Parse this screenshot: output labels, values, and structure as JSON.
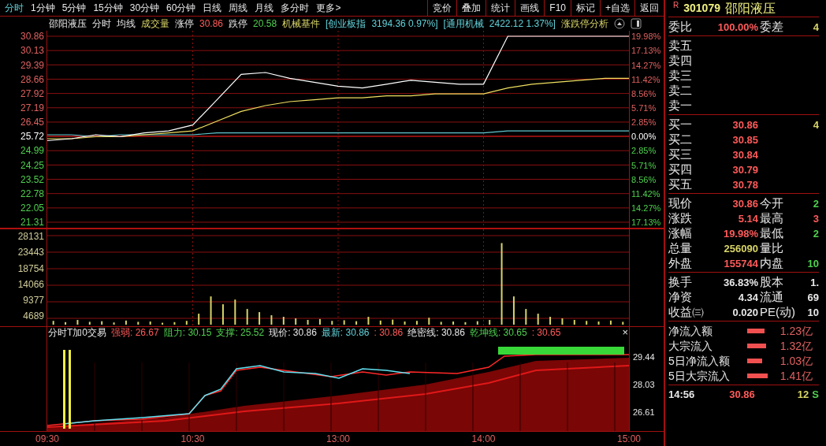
{
  "menu": {
    "tabs": [
      {
        "label": "分时",
        "selected": true
      },
      {
        "label": "1分钟",
        "selected": false
      },
      {
        "label": "5分钟",
        "selected": false
      },
      {
        "label": "15分钟",
        "selected": false
      },
      {
        "label": "30分钟",
        "selected": false
      },
      {
        "label": "60分钟",
        "selected": false
      },
      {
        "label": "日线",
        "selected": false
      },
      {
        "label": "周线",
        "selected": false
      },
      {
        "label": "月线",
        "selected": false
      },
      {
        "label": "多分时",
        "selected": false
      },
      {
        "label": "更多>",
        "selected": false
      }
    ],
    "tools": [
      "竞价",
      "叠加",
      "统计",
      "画线",
      "F10",
      "标记",
      "+自选",
      "返回"
    ]
  },
  "chart_header": [
    {
      "text": "邵阳液压",
      "kind": "flat"
    },
    {
      "text": "分时",
      "kind": "flat"
    },
    {
      "text": "均线",
      "kind": "flat"
    },
    {
      "text": "成交量",
      "kind": "vol"
    },
    {
      "text": "涨停",
      "kind": "flat"
    },
    {
      "text": "30.86",
      "kind": "up"
    },
    {
      "text": "跌停",
      "kind": "flat"
    },
    {
      "text": "20.58",
      "kind": "down"
    },
    {
      "text": "机械基件",
      "kind": "vol"
    },
    {
      "text": "[创业板指",
      "kind": "index"
    },
    {
      "text": "3194.36 0.97%]",
      "kind": "index"
    },
    {
      "text": "[通用机械",
      "kind": "index"
    },
    {
      "text": "2422.12 1.37%]",
      "kind": "index"
    },
    {
      "text": "涨跌停分析",
      "kind": "vol"
    }
  ],
  "price_axis": [
    {
      "label": "30.86",
      "kind": "up"
    },
    {
      "label": "30.13",
      "kind": "up"
    },
    {
      "label": "29.39",
      "kind": "up"
    },
    {
      "label": "28.66",
      "kind": "up"
    },
    {
      "label": "27.92",
      "kind": "up"
    },
    {
      "label": "27.19",
      "kind": "up"
    },
    {
      "label": "26.45",
      "kind": "up"
    },
    {
      "label": "25.72",
      "kind": "flat"
    },
    {
      "label": "24.99",
      "kind": "down"
    },
    {
      "label": "24.25",
      "kind": "down"
    },
    {
      "label": "23.52",
      "kind": "down"
    },
    {
      "label": "22.78",
      "kind": "down"
    },
    {
      "label": "22.05",
      "kind": "down"
    },
    {
      "label": "21.31",
      "kind": "down"
    }
  ],
  "percent_axis": [
    {
      "label": "19.98%",
      "kind": "up"
    },
    {
      "label": "17.13%",
      "kind": "up"
    },
    {
      "label": "14.27%",
      "kind": "up"
    },
    {
      "label": "11.42%",
      "kind": "up"
    },
    {
      "label": "8.56%",
      "kind": "up"
    },
    {
      "label": "5.71%",
      "kind": "up"
    },
    {
      "label": "2.85%",
      "kind": "up"
    },
    {
      "label": "0.00%",
      "kind": "flat"
    },
    {
      "label": "2.85%",
      "kind": "down"
    },
    {
      "label": "5.71%",
      "kind": "down"
    },
    {
      "label": "8.56%",
      "kind": "down"
    },
    {
      "label": "11.42%",
      "kind": "down"
    },
    {
      "label": "14.27%",
      "kind": "down"
    },
    {
      "label": "17.13%",
      "kind": "down"
    }
  ],
  "volume_axis": [
    "28131",
    "23443",
    "18754",
    "14066",
    "9377",
    "4689"
  ],
  "indicator": {
    "title": "分时T加0交易",
    "segments": [
      {
        "text": "强弱: 26.67",
        "kind": "up"
      },
      {
        "text": "阻力: 30.15",
        "kind": "down"
      },
      {
        "text": "支撑: 25.52",
        "kind": "down"
      },
      {
        "text": "现价: 30.86",
        "kind": "flat"
      },
      {
        "text": "最新: 30.86",
        "kind": "index"
      },
      {
        "text": ": 30.86",
        "kind": "up"
      },
      {
        "text": "绝密线: 30.86",
        "kind": "flat"
      },
      {
        "text": "乾坤线: 30.65",
        "kind": "down"
      },
      {
        "text": ": 30.65",
        "kind": "up"
      }
    ],
    "close": "×",
    "axis": [
      "29.44",
      "28.03",
      "26.61"
    ]
  },
  "time_axis": [
    "09:30",
    "10:30",
    "13:00",
    "14:00",
    "15:00"
  ],
  "quote": {
    "badge": "R",
    "code": "301079",
    "name": "邵阳液压",
    "committee": [
      {
        "label": "委比",
        "value": "100.00%"
      },
      {
        "label": "委差",
        "value": "4"
      }
    ],
    "sell": [
      "卖五",
      "卖四",
      "卖三",
      "卖二",
      "卖一"
    ],
    "buy": [
      {
        "label": "买一",
        "price": "30.86",
        "volume": "4"
      },
      {
        "label": "买二",
        "price": "30.85"
      },
      {
        "label": "买三",
        "price": "30.84"
      },
      {
        "label": "买四",
        "price": "30.79"
      },
      {
        "label": "买五",
        "price": "30.78"
      }
    ],
    "stats": [
      {
        "label": "现价",
        "value": "30.86",
        "kind": "up",
        "right": {
          "label": "今开",
          "value": "2",
          "kind": "down"
        }
      },
      {
        "label": "涨跌",
        "value": "5.14",
        "kind": "up",
        "right": {
          "label": "最高",
          "value": "3",
          "kind": "up"
        }
      },
      {
        "label": "涨幅",
        "value": "19.98%",
        "kind": "up",
        "right": {
          "label": "最低",
          "value": "2",
          "kind": "down"
        }
      },
      {
        "label": "总量",
        "value": "256090",
        "kind": "vol",
        "right": {
          "label": "量比"
        }
      },
      {
        "label": "外盘",
        "value": "155744",
        "kind": "up",
        "right": {
          "label": "内盘",
          "value": "10",
          "kind": "down"
        }
      }
    ],
    "shares": [
      {
        "label": "换手",
        "value": "36.83%",
        "label2": "股本",
        "value2": "1."
      },
      {
        "label": "净资",
        "value": "4.34",
        "label2": "流通",
        "value2": "69"
      },
      {
        "label": "收益㈢",
        "value": "0.020",
        "label2": "PE(动)",
        "value2": "10"
      }
    ],
    "flows": [
      {
        "label": "净流入额",
        "value": "1.23亿"
      },
      {
        "label": "大宗流入",
        "value": "1.32亿"
      },
      {
        "label": "5日净流入额",
        "value": "1.03亿"
      },
      {
        "label": "5日大宗流入",
        "value": "1.41亿"
      }
    ],
    "trades": [
      {
        "time": "14:56",
        "price": "30.86",
        "volume": "12",
        "side": "S"
      }
    ]
  }
}
